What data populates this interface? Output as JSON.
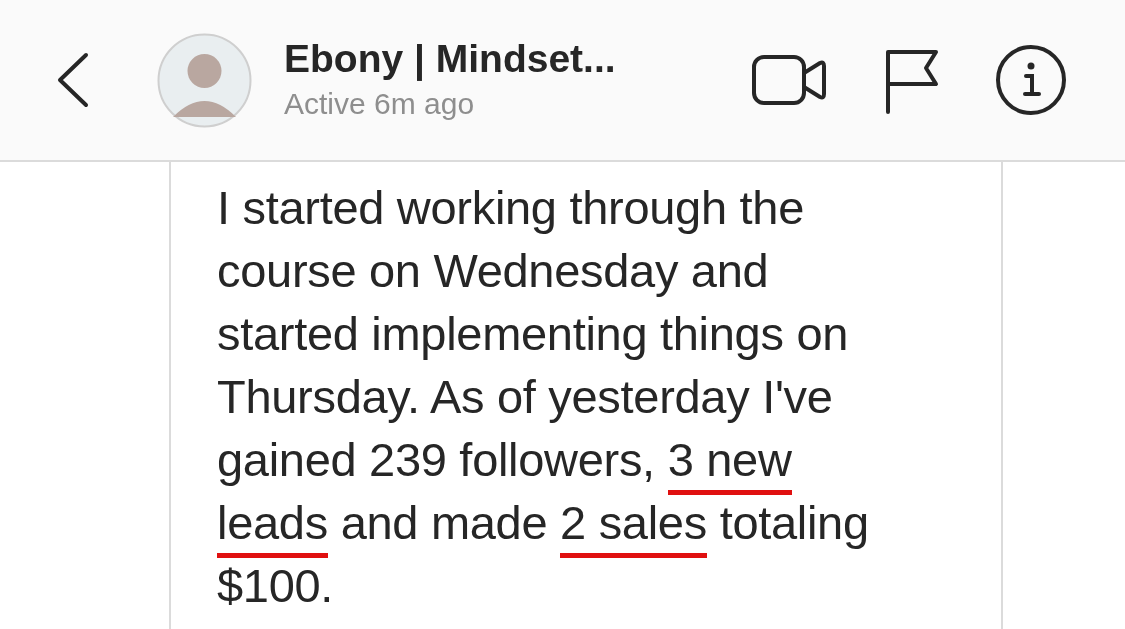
{
  "header": {
    "name": "Ebony | Mindset...",
    "status": "Active 6m ago"
  },
  "message": {
    "segments": [
      {
        "text": "I started working through the course on Wednesday and started implementing things on Thursday. As of yesterday I've gained 239 followers, ",
        "underlined": false
      },
      {
        "text": "3 new leads",
        "underlined": true
      },
      {
        "text": " and made ",
        "underlined": false
      },
      {
        "text": "2 sales",
        "underlined": true
      },
      {
        "text": " totaling $100.",
        "underlined": false
      }
    ]
  }
}
